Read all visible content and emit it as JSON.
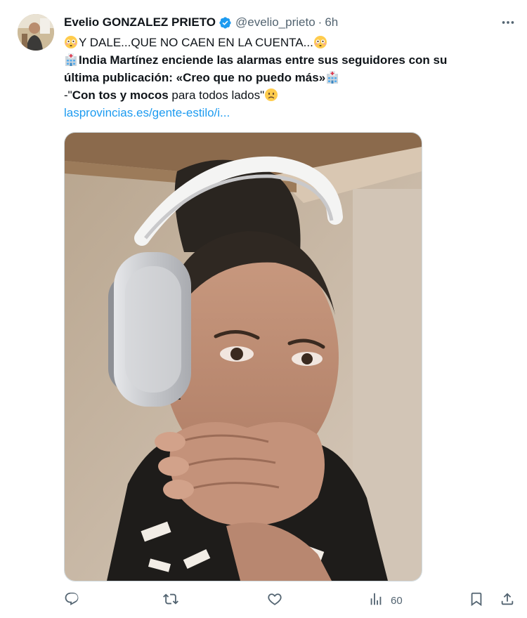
{
  "tweet": {
    "author": {
      "display_name": "Evelio GONZALEZ PRIETO",
      "handle": "@evelio_prieto",
      "separator": "·",
      "time": "6h",
      "verified": true
    },
    "text": {
      "line1": "Y DALE...QUE NO CAEN EN LA CUENTA...",
      "line2": "India Martínez enciende las alarmas entre sus seguidores con su",
      "line3": "última publicación: «Creo que no puedo más»",
      "line4_prefix": "-\"",
      "line4_bold": "Con tos y mocos",
      "line4_rest": " para todos lados\"",
      "link": "lasprovincias.es/gente-estilo/i..."
    },
    "emojis": [
      "flushed-face",
      "hospital",
      "slightly-frowning-face"
    ],
    "media": {
      "type": "photo",
      "subject": "woman-with-headphones-covering-mouth"
    },
    "actions": {
      "views_count": "60"
    },
    "colors": {
      "accent": "#1d9bf0",
      "secondary_text": "#536471",
      "primary_text": "#0f1419"
    }
  }
}
